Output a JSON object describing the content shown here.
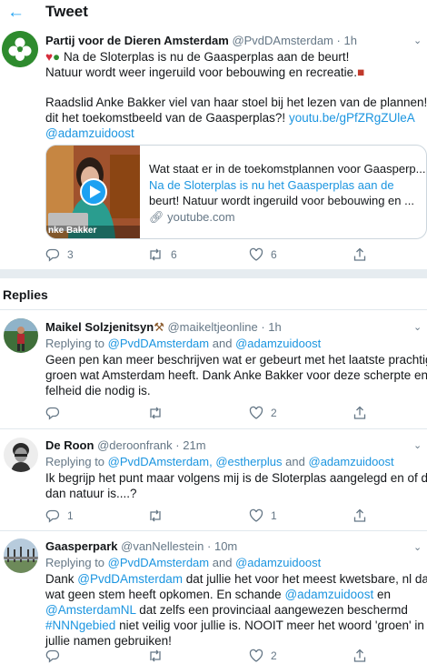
{
  "header": {
    "back_icon": "back-arrow-icon",
    "title": "Tweet"
  },
  "tweet": {
    "author_name": "Partij voor de Dieren Amsterdam",
    "handle": "@PvdDAmsterdam",
    "separator": "·",
    "time": "1h",
    "line1_text": "Na de Sloterplas is nu de Gaasperplas aan de beurt!",
    "line2_text": "Natuur wordt weer ingeruild voor bebouwing en recreatie.",
    "line3_text": "Raadslid Anke Bakker viel van haar stoel bij het lezen van de plannen! Is",
    "line4_text": "dit het toekomstbeeld van de Gaasperplas?!",
    "line4_link": "youtu.be/gPfZRgZUleA",
    "line5_link": "@adamzuidoost",
    "card": {
      "title": "Wat staat er in de toekomstplannen voor Gaasperp...",
      "desc1": "Na de Sloterplas is nu het Gaasperplas aan de",
      "desc2": "beurt! Natuur wordt ingeruild voor bebouwing en ...",
      "domain": "youtube.com",
      "thumb_caption": "nke Bakker"
    },
    "replies_count": "3",
    "retweets_count": "6",
    "likes_count": "6"
  },
  "replies_section_title": "Replies",
  "replies": [
    {
      "author_name": "Maikel Solzjenitsyn",
      "handle": "@maikeltjeonline",
      "separator": "·",
      "time": "1h",
      "replying_prefix": "Replying to",
      "replying_to_1": "@PvdDAmsterdam",
      "replying_and": "and",
      "replying_to_2": "@adamzuidoost",
      "line1": "Geen pen kan meer beschrijven wat er gebeurt met het laatste prachtige",
      "line2": "groen wat Amsterdam heeft. Dank Anke Bakker voor deze scherpte en",
      "line3": "felheid die nodig is.",
      "replies_count": "",
      "retweets_count": "",
      "likes_count": "2"
    },
    {
      "author_name": "De Roon",
      "handle": "@deroonfrank",
      "separator": "·",
      "time": "21m",
      "replying_prefix": "Replying to",
      "replying_to_1": "@PvdDAmsterdam,",
      "replying_to_2": "@estherplus",
      "replying_and": "and",
      "replying_to_3": "@adamzuidoost",
      "line1": "Ik begrijp het punt maar volgens mij is de Sloterplas aangelegd en of dat",
      "line2": "dan natuur is....?",
      "replies_count": "1",
      "retweets_count": "",
      "likes_count": "1"
    },
    {
      "author_name": "Gaasperpark",
      "handle": "@vanNellestein",
      "separator": "·",
      "time": "10m",
      "replying_prefix": "Replying to",
      "replying_to_1": "@PvdDAmsterdam",
      "replying_and": "and",
      "replying_to_2": "@adamzuidoost",
      "line1_a": "Dank",
      "line1_link": "@PvdDAmsterdam",
      "line1_b": "dat jullie het voor het meest kwetsbare, nl dat",
      "line2": "wat geen stem heeft opkomen. En schande",
      "line2_link": "@adamzuidoost",
      "line2_b": "en",
      "line3_link": "@AmsterdamNL",
      "line3_b": "dat zelfs een provinciaal aangewezen beschermd",
      "line4_link": "#NNNgebied",
      "line4_b": "niet veilig voor jullie is. NOOIT meer het woord 'groen' in",
      "line5": "jullie namen gebruiken!",
      "replies_count": "",
      "retweets_count": "",
      "likes_count": "2"
    }
  ],
  "colors": {
    "accent": "#1da1f2",
    "link": "#1b95e0",
    "muted": "#657786",
    "party_green": "#2e8b2e"
  }
}
